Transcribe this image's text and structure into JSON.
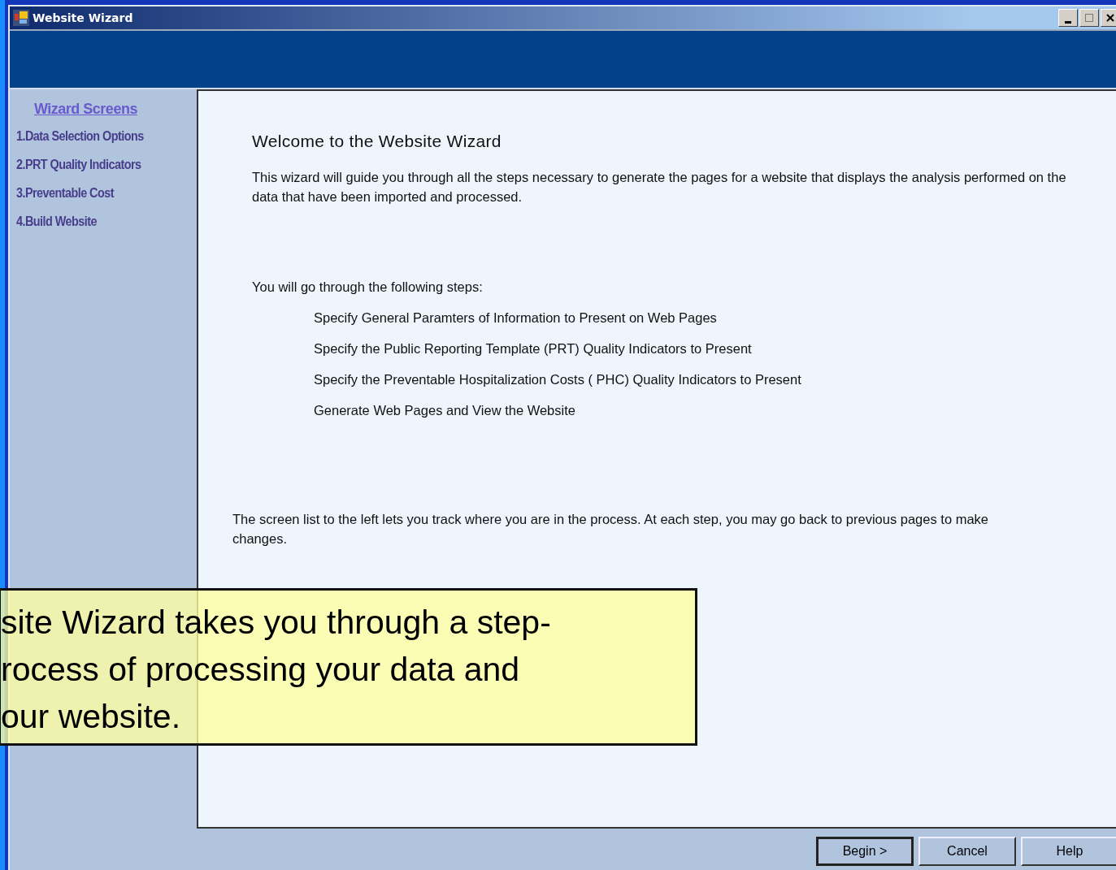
{
  "window": {
    "title": "Website Wizard"
  },
  "sidebar": {
    "heading": "Wizard Screens",
    "items": [
      {
        "label": "1.Data Selection Options"
      },
      {
        "label": "2.PRT Quality Indicators"
      },
      {
        "label": "3.Preventable Cost"
      },
      {
        "label": "4.Build Website"
      }
    ]
  },
  "content": {
    "title": "Welcome to the Website Wizard",
    "intro": "This wizard will guide you through all the steps necessary to generate the pages for a website that displays the analysis performed on the data that have been imported and processed.",
    "steps_heading": "You will go through the following steps:",
    "steps": [
      "Specify General Paramters of Information to Present on Web Pages",
      "Specify the Public Reporting Template (PRT) Quality Indicators to Present",
      "Specify the Preventable Hospitalization Costs ( PHC) Quality Indicators to Present",
      "Generate Web Pages and View the Website"
    ],
    "note": "The screen list to the left lets you track where you are in the process.  At each step, you may go back to previous pages to make changes."
  },
  "buttons": [
    "Begin >",
    "Cancel",
    "Help"
  ],
  "callout": {
    "lines": [
      "site Wizard takes you through a step-",
      "rocess of processing your data and",
      "our website."
    ]
  }
}
